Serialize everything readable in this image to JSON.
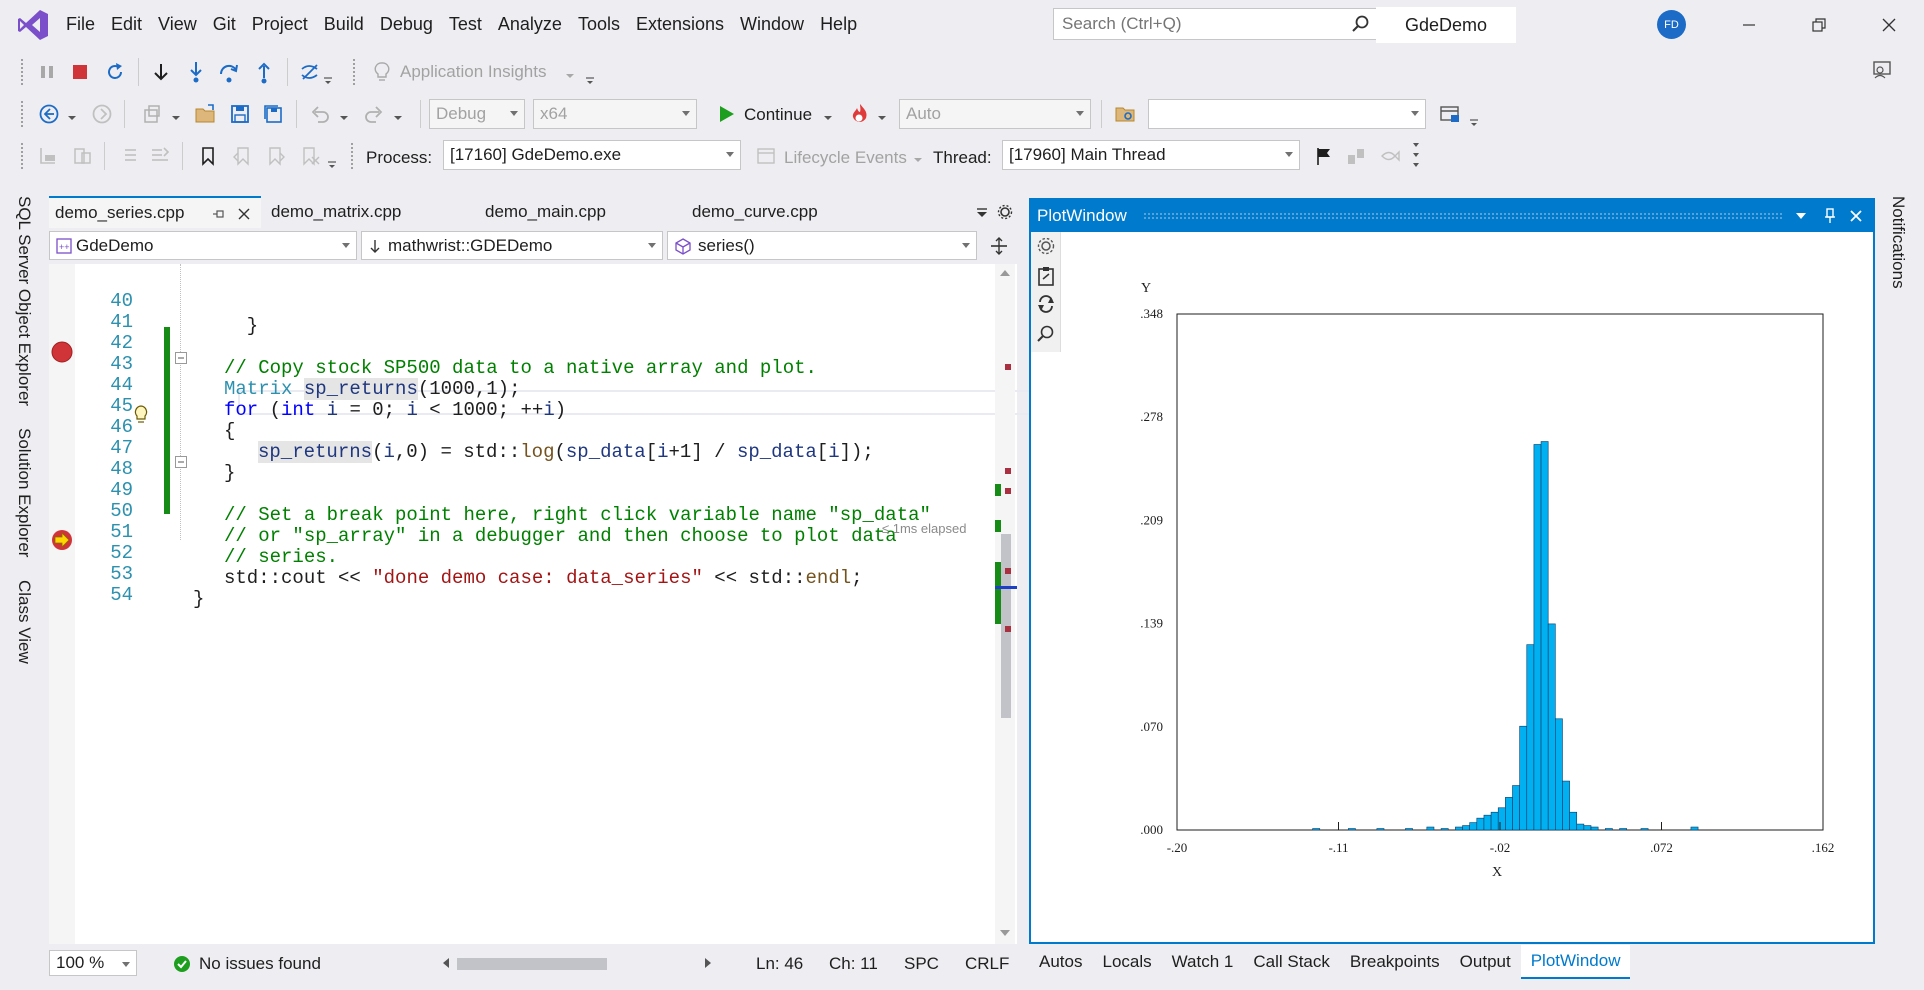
{
  "menu": [
    "File",
    "Edit",
    "View",
    "Git",
    "Project",
    "Build",
    "Debug",
    "Test",
    "Analyze",
    "Tools",
    "Extensions",
    "Window",
    "Help"
  ],
  "search": {
    "placeholder": "Search (Ctrl+Q)"
  },
  "solution_name": "GdeDemo",
  "user_initials": "FD",
  "toolbar1": {
    "app_insights": "Application Insights"
  },
  "toolbar2": {
    "config": "Debug",
    "platform": "x64",
    "continue": "Continue",
    "auto": "Auto"
  },
  "toolbar3": {
    "process_label": "Process:",
    "process_value": "[17160] GdeDemo.exe",
    "lifecycle": "Lifecycle Events",
    "thread_label": "Thread:",
    "thread_value": "[17960] Main Thread"
  },
  "left_tabs": [
    "SQL Server Object Explorer",
    "Solution Explorer",
    "Class View"
  ],
  "right_tabs": [
    "Notifications"
  ],
  "doc_tabs": [
    "demo_series.cpp",
    "demo_matrix.cpp",
    "demo_main.cpp",
    "demo_curve.cpp"
  ],
  "nav": {
    "project": "GdeDemo",
    "scope": "mathwrist::GDEDemo",
    "member": "series()"
  },
  "code_lines": [
    {
      "n": "40",
      "text": "  }"
    },
    {
      "n": "41",
      "text": ""
    },
    {
      "n": "42",
      "text": "// Copy stock SP500 data to a native array and plot."
    },
    {
      "n": "43",
      "text": "Matrix sp_returns(1000,1);"
    },
    {
      "n": "44",
      "text": "for (int i = 0; i < 1000; ++i)"
    },
    {
      "n": "45",
      "text": "{"
    },
    {
      "n": "46",
      "text": "sp_returns(i,0) = std::log(sp_data[i+1] / sp_data[i]);"
    },
    {
      "n": "47",
      "text": "}"
    },
    {
      "n": "48",
      "text": ""
    },
    {
      "n": "49",
      "text": "// Set a break point here, right click variable name \"sp_data\""
    },
    {
      "n": "50",
      "text": "// or \"sp_array\" in a debugger and then choose to plot data"
    },
    {
      "n": "51",
      "text": "// series."
    },
    {
      "n": "52",
      "text": "std::cout << \"done demo case: data_series\" << std::endl;"
    },
    {
      "n": "53",
      "text": "}"
    },
    {
      "n": "54",
      "text": ""
    }
  ],
  "elapsed_hint": "≤ 1ms elapsed",
  "editor_status": {
    "zoom": "100 %",
    "issues": "No issues found",
    "ln": "Ln: 46",
    "ch": "Ch: 11",
    "spc": "SPC",
    "crlf": "CRLF"
  },
  "plot_window": {
    "title": "PlotWindow"
  },
  "bottom_tabs": [
    "Autos",
    "Locals",
    "Watch 1",
    "Call Stack",
    "Breakpoints",
    "Output",
    "PlotWindow"
  ],
  "colors": {
    "accent": "#007acc",
    "bar_fill": "#00b0f0",
    "breakpoint": "#d13438",
    "change_bar": "#168b16"
  },
  "chart_data": {
    "type": "bar",
    "xlabel": "X",
    "ylabel": "Y",
    "xlim": [
      -0.2,
      0.162
    ],
    "ylim": [
      0.0,
      0.348
    ],
    "x_ticks": [
      "-.20",
      "-.11",
      "-.02",
      ".072",
      ".162"
    ],
    "y_ticks": [
      ".000",
      ".070",
      ".139",
      ".209",
      ".278",
      ".348"
    ],
    "bin_width": 0.004,
    "bins": [
      {
        "x": -0.124,
        "y": 0.001
      },
      {
        "x": -0.104,
        "y": 0.001
      },
      {
        "x": -0.088,
        "y": 0.001
      },
      {
        "x": -0.072,
        "y": 0.001
      },
      {
        "x": -0.06,
        "y": 0.002
      },
      {
        "x": -0.052,
        "y": 0.001
      },
      {
        "x": -0.044,
        "y": 0.002
      },
      {
        "x": -0.04,
        "y": 0.003
      },
      {
        "x": -0.036,
        "y": 0.005
      },
      {
        "x": -0.032,
        "y": 0.008
      },
      {
        "x": -0.028,
        "y": 0.01
      },
      {
        "x": -0.024,
        "y": 0.012
      },
      {
        "x": -0.02,
        "y": 0.015
      },
      {
        "x": -0.016,
        "y": 0.022
      },
      {
        "x": -0.012,
        "y": 0.03
      },
      {
        "x": -0.008,
        "y": 0.07
      },
      {
        "x": -0.004,
        "y": 0.125
      },
      {
        "x": 0.0,
        "y": 0.26
      },
      {
        "x": 0.004,
        "y": 0.262
      },
      {
        "x": 0.008,
        "y": 0.139
      },
      {
        "x": 0.012,
        "y": 0.075
      },
      {
        "x": 0.016,
        "y": 0.033
      },
      {
        "x": 0.02,
        "y": 0.012
      },
      {
        "x": 0.024,
        "y": 0.004
      },
      {
        "x": 0.028,
        "y": 0.003
      },
      {
        "x": 0.032,
        "y": 0.002
      },
      {
        "x": 0.04,
        "y": 0.001
      },
      {
        "x": 0.048,
        "y": 0.001
      },
      {
        "x": 0.06,
        "y": 0.001
      },
      {
        "x": 0.088,
        "y": 0.002
      }
    ]
  }
}
